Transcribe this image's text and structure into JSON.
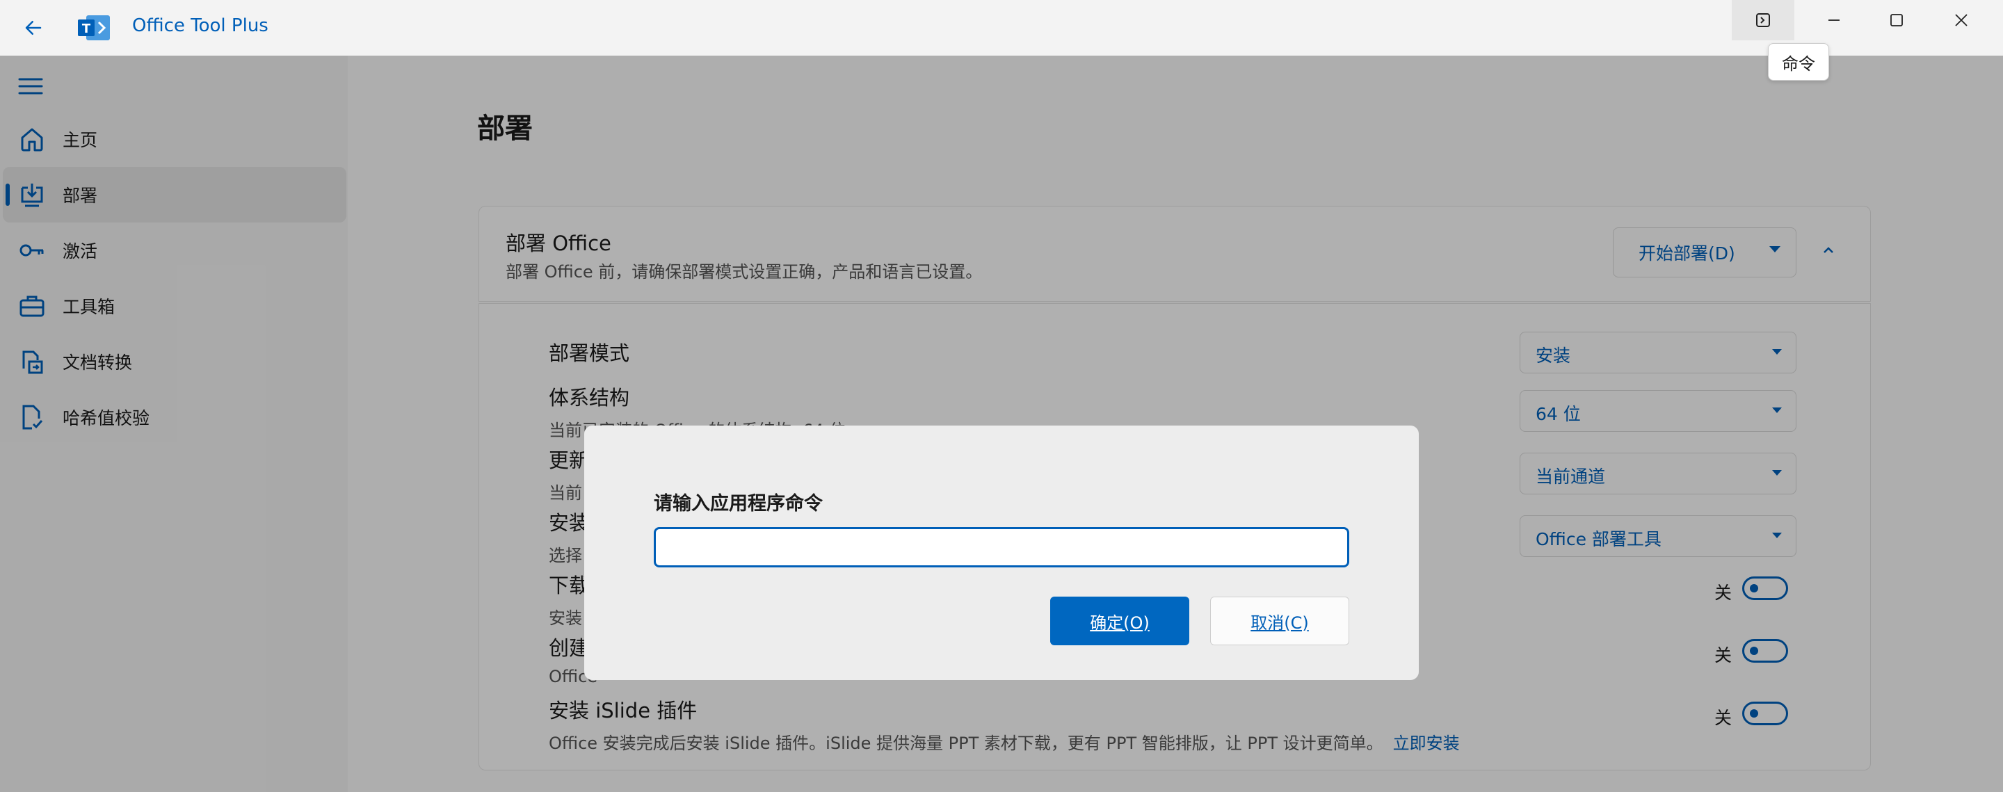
{
  "window": {
    "title": "Office Tool Plus",
    "command_tooltip": "命令",
    "icons": {
      "back": "back-arrow-icon",
      "command": "command-prompt-icon",
      "minimize": "minimize-icon",
      "maximize": "maximize-icon",
      "close": "close-icon"
    }
  },
  "nav": {
    "items": [
      {
        "label": "主页",
        "icon": "home-icon"
      },
      {
        "label": "部署",
        "icon": "deploy-download-icon",
        "selected": true
      },
      {
        "label": "激活",
        "icon": "key-icon"
      },
      {
        "label": "工具箱",
        "icon": "toolbox-icon"
      },
      {
        "label": "文档转换",
        "icon": "document-convert-icon"
      },
      {
        "label": "哈希值校验",
        "icon": "document-check-icon"
      }
    ]
  },
  "main": {
    "page_title": "部署",
    "card": {
      "title": "部署 Office",
      "subtitle": "部署 Office 前，请确保部署模式设置正确，产品和语言已设置。",
      "deploy_button": "开始部署(D)"
    },
    "settings": [
      {
        "title": "部署模式",
        "desc": "",
        "value": "安装"
      },
      {
        "title": "体系结构",
        "desc": "当前已安装的 Office 的体系结构: 64 位",
        "value": "64 位"
      },
      {
        "title": "更新",
        "desc": "当前",
        "value": "当前通道"
      },
      {
        "title": "安装",
        "desc": "选择",
        "value": "Office 部署工具"
      },
      {
        "title": "下载",
        "desc": "安装",
        "toggle": "关"
      },
      {
        "title": "创建",
        "desc": "Office",
        "toggle": "关"
      },
      {
        "title": "安装 iSlide 插件",
        "desc": "Office 安装完成后安装 iSlide 插件。iSlide 提供海量 PPT 素材下载，更有 PPT 智能排版，让 PPT 设计更简单。",
        "link": "立即安装",
        "toggle": "关"
      }
    ]
  },
  "dialog": {
    "prompt": "请输入应用程序命令",
    "input_value": "",
    "ok": "确定(O)",
    "cancel": "取消(C)"
  },
  "colors": {
    "accent": "#005fb8",
    "primary_button": "#0067c0"
  }
}
